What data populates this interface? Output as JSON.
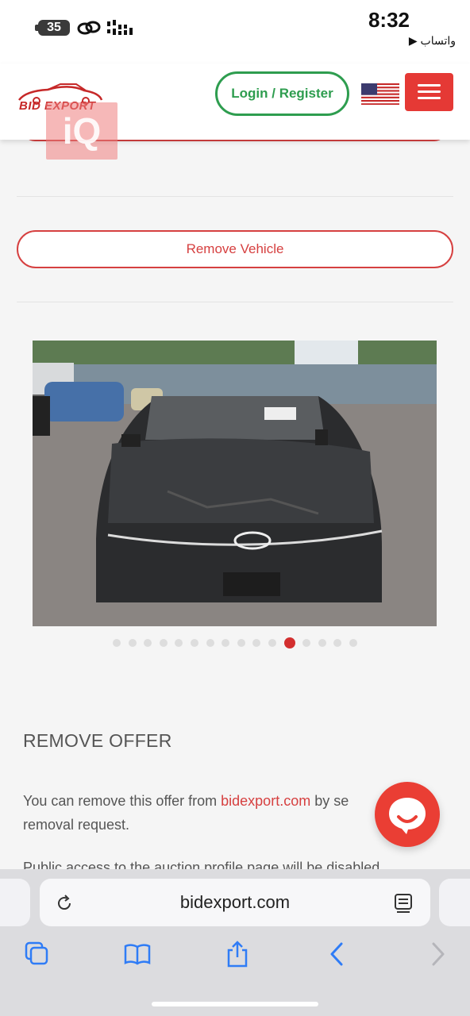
{
  "status_bar": {
    "battery": "35",
    "time": "8:32",
    "back_app": "▶ واتساب"
  },
  "header": {
    "logo_text": "BID EXPORT",
    "watermark_text": "iQ",
    "login_label": "Login / Register",
    "flag_icon": "us-flag-icon",
    "menu_icon": "hamburger-menu-icon"
  },
  "actions": {
    "remove_vehicle_label": "Remove Vehicle"
  },
  "gallery": {
    "photo_description_icon": "car-photo",
    "dot_count": 16,
    "active_index": 11
  },
  "remove_offer": {
    "title": "REMOVE OFFER",
    "text_before": "You can remove this offer from ",
    "link": "bidexport.com",
    "text_after": " by se",
    "text_line2": "removal request.",
    "text_partial": "Public access to the auction profile page will be disabled"
  },
  "browser": {
    "url": "bidexport.com",
    "reload_icon": "reload-icon",
    "reader_icon": "reader-icon",
    "toolbar": [
      "tabs-icon",
      "bookmarks-icon",
      "share-icon",
      "back-icon",
      "forward-icon"
    ]
  },
  "colors": {
    "accent_red": "#d64040",
    "green": "#2e9d4f",
    "ios_blue": "#2f7cf6"
  }
}
